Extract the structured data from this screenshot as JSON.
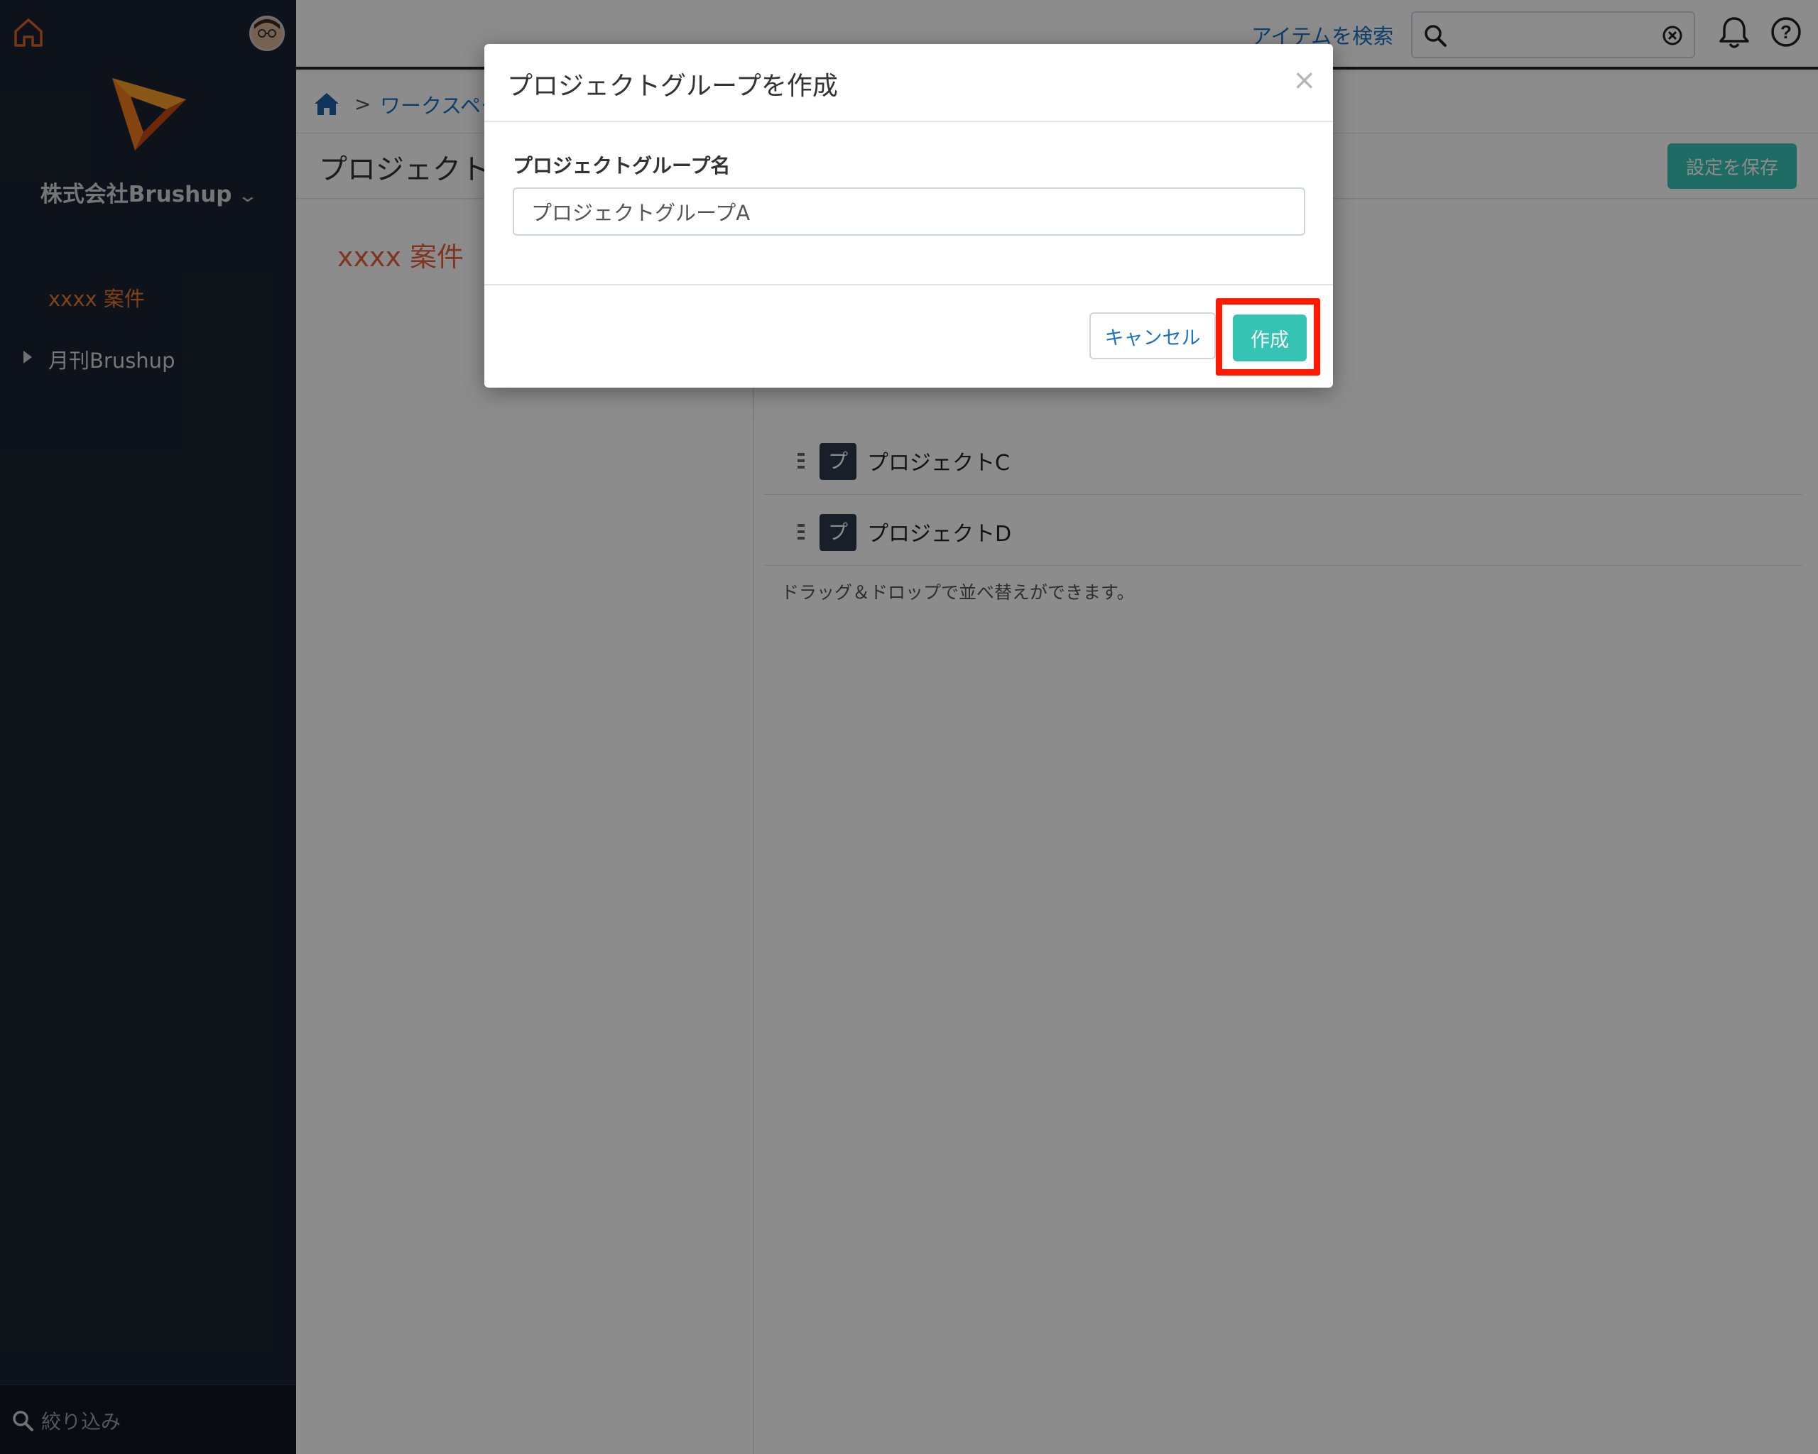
{
  "sidebar": {
    "org_name": "株式会社Brushup",
    "active_item": "xxxx 案件",
    "group_item": "月刊Brushup",
    "filter_placeholder": "絞り込み"
  },
  "header": {
    "search_link": "アイテムを検索",
    "search_value": ""
  },
  "breadcrumb": {
    "separator": ">",
    "workspace": "ワークスペー"
  },
  "page": {
    "title": "プロジェクト",
    "save_button": "設定を保存",
    "left_case": "xxxx 案件",
    "projects": [
      {
        "tile": "プ",
        "name": "プロジェクトC"
      },
      {
        "tile": "プ",
        "name": "プロジェクトD"
      }
    ],
    "hint": "ドラッグ＆ドロップで並べ替えができます。"
  },
  "modal": {
    "title": "プロジェクトグループを作成",
    "close": "×",
    "field_label": "プロジェクトグループ名",
    "field_value": "プロジェクトグループA",
    "cancel_button": "キャンセル",
    "create_button": "作成"
  },
  "colors": {
    "accent": "#35c3b4",
    "link": "#1a73c4",
    "highlight": "#ff1a00",
    "sidebar_bg": "#1b2230",
    "active_nav": "#e87a2a"
  }
}
